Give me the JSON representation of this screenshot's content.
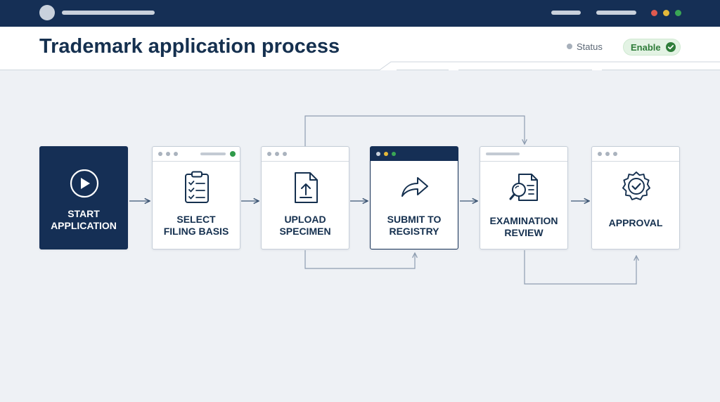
{
  "header": {
    "title": "Trademark application process",
    "status_label": "Status",
    "enable_label": "Enable"
  },
  "steps": [
    {
      "label_line1": "START",
      "label_line2": "APPLICATION",
      "icon": "play-icon"
    },
    {
      "label_line1": "SELECT",
      "label_line2": "FILING BASIS",
      "icon": "checklist-icon"
    },
    {
      "label_line1": "UPLOAD",
      "label_line2": "SPECIMEN",
      "icon": "upload-icon"
    },
    {
      "label_line1": "SUBMIT TO",
      "label_line2": "REGISTRY",
      "icon": "share-arrow-icon"
    },
    {
      "label_line1": "EXAMINATION",
      "label_line2": "REVIEW",
      "icon": "document-search-icon"
    },
    {
      "label_line1": "APPROVAL",
      "label_line2": "",
      "icon": "certificate-badge-icon"
    }
  ],
  "colors": {
    "navy": "#152f55",
    "accent_green": "#2f7d3a",
    "window_yellow": "#e5b93a",
    "window_red": "#e05a4f"
  }
}
